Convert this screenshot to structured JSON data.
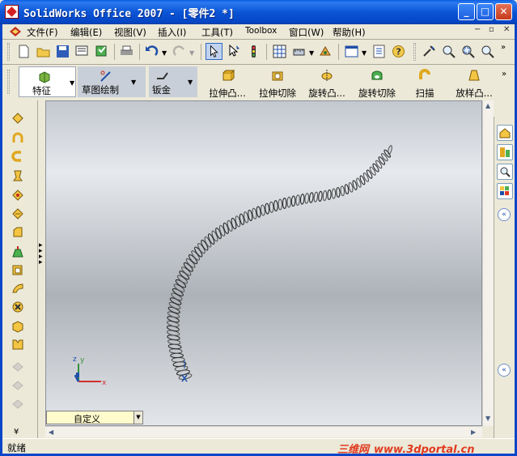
{
  "window": {
    "title": "SolidWorks Office 2007 - [零件2 *]",
    "buttons": {
      "minimize": "_",
      "maximize": "□",
      "close": "✕"
    }
  },
  "menubar": {
    "items": [
      {
        "label": "文件(F)"
      },
      {
        "label": "编辑(E)"
      },
      {
        "label": "视图(V)"
      },
      {
        "label": "插入(I)"
      },
      {
        "label": "工具(T)"
      },
      {
        "label": "Toolbox"
      },
      {
        "label": "窗口(W)"
      },
      {
        "label": "帮助(H)"
      }
    ],
    "doc_controls": [
      "−",
      "▫",
      "✕"
    ]
  },
  "commandmanager": {
    "tabs": [
      {
        "label": "特征"
      },
      {
        "label": "草图绘制"
      },
      {
        "label": "钣金"
      }
    ],
    "tools": [
      {
        "label": "拉伸凸..."
      },
      {
        "label": "拉伸切除"
      },
      {
        "label": "旋转凸..."
      },
      {
        "label": "旋转切除"
      },
      {
        "label": "扫描"
      },
      {
        "label": "放样凸..."
      }
    ]
  },
  "viewport": {
    "view_combo_value": "自定义"
  },
  "statusbar": {
    "text": "就绪",
    "watermark_cn": "三维网",
    "watermark_url": "www.3dportal.cn"
  },
  "colors": {
    "title_bar": "#0A55D6",
    "viewport_top": "#C3C8CF",
    "viewport_mid": "#E6E9ED",
    "watermark": "#E0391F"
  }
}
